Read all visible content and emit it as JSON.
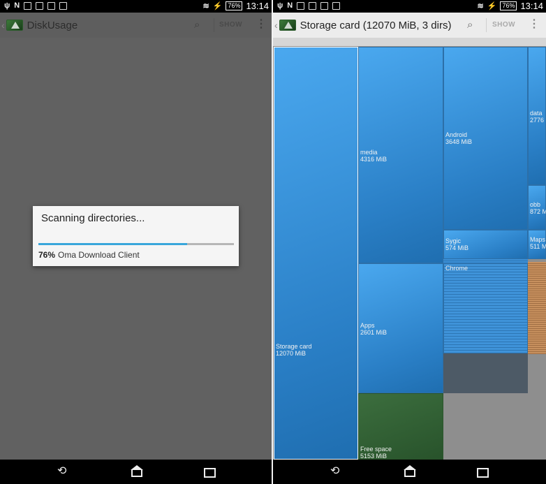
{
  "left": {
    "status_bar": {
      "battery": "76%",
      "time": "13:14",
      "notif_glyph": "N"
    },
    "action_bar": {
      "title": "DiskUsage",
      "show_label": "SHOW"
    },
    "dialog": {
      "title": "Scanning directories...",
      "progress_fraction": 0.76,
      "percent_text": "76%",
      "current_item": "Oma Download Client"
    }
  },
  "right": {
    "status_bar": {
      "battery": "76%",
      "time": "13:14",
      "notif_glyph": "N"
    },
    "action_bar": {
      "title": "Storage card (12070 MiB, 3 dirs)",
      "show_label": "SHOW"
    },
    "treemap": {
      "storage_card": {
        "name": "Storage card",
        "size": "12070 MiB"
      },
      "media": {
        "name": "media",
        "size": "4316 MiB"
      },
      "android": {
        "name": "Android",
        "size": "3648 MiB"
      },
      "data": {
        "name": "data",
        "size": "2776"
      },
      "obb": {
        "name": "obb",
        "size": "872 M"
      },
      "sygic": {
        "name": "Sygic",
        "size": "574 MiB"
      },
      "maps": {
        "name": "Maps",
        "size": "511 M"
      },
      "chrome": {
        "name": "Chrome"
      },
      "apps": {
        "name": "Apps",
        "size": "2601 MiB"
      },
      "free_space": {
        "name": "Free space",
        "size": "5153 MiB"
      }
    }
  },
  "icons": [
    "usb-icon",
    "notification-icon",
    "screenshot-icon",
    "image-icon",
    "gallery-icon",
    "mail-icon",
    "wifi-icon",
    "battery-icon",
    "back-icon",
    "home-icon",
    "recents-icon",
    "search-icon",
    "more-vert-icon",
    "app-logo-icon"
  ],
  "colors": {
    "accent": "#39a6db",
    "tile_blue": "#2a7fc6",
    "free_space_green": "#3c6e3e"
  }
}
